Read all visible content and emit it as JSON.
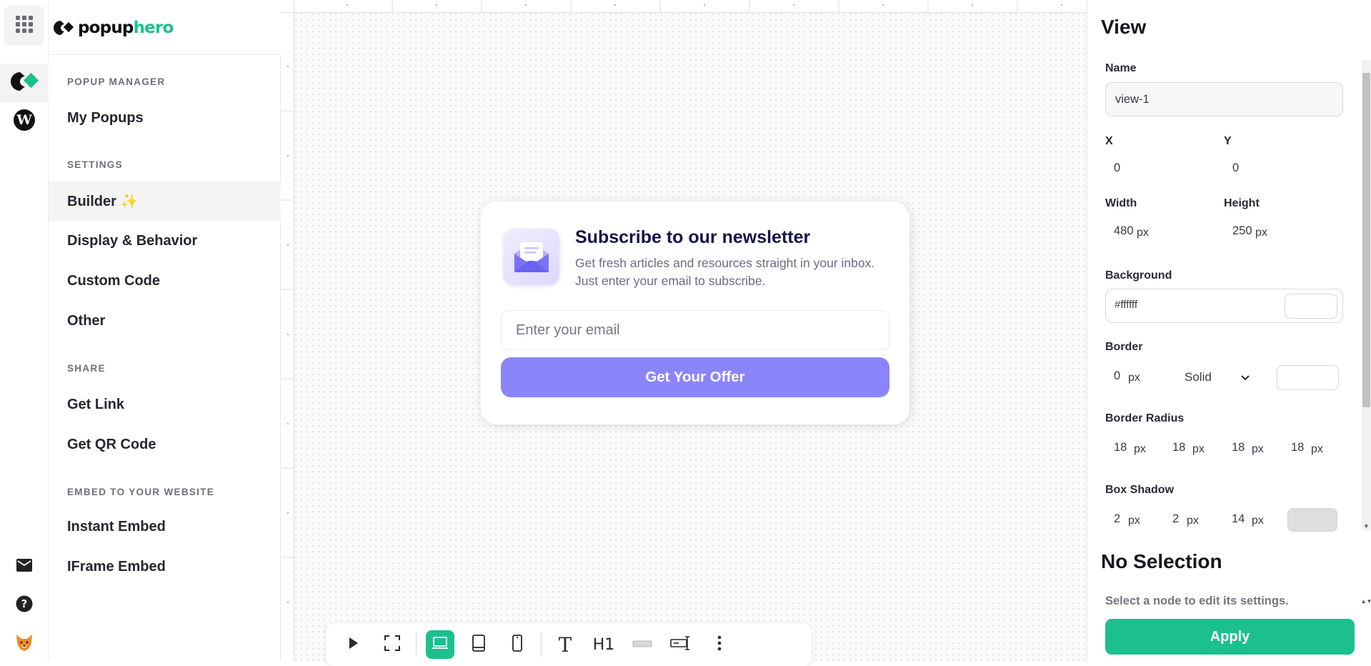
{
  "brand": {
    "part1": "popup",
    "part2": "hero"
  },
  "rail": {
    "apps_icon": "grid-icon",
    "items": [
      {
        "name": "popuphero-logo-icon"
      },
      {
        "name": "wordpress-icon"
      }
    ],
    "bottom": [
      {
        "name": "mail-icon"
      },
      {
        "name": "help-icon"
      },
      {
        "name": "fox-avatar-icon"
      }
    ]
  },
  "nav": {
    "sections": [
      {
        "title": "POPUP MANAGER",
        "items": [
          "My Popups"
        ]
      },
      {
        "title": "SETTINGS",
        "items": [
          "Builder ✨",
          "Display & Behavior",
          "Custom Code",
          "Other"
        ]
      },
      {
        "title": "SHARE",
        "items": [
          "Get Link",
          "Get QR Code"
        ]
      },
      {
        "title": "EMBED TO YOUR WEBSITE",
        "items": [
          "Instant Embed",
          "IFrame Embed"
        ]
      }
    ],
    "active": "Builder ✨"
  },
  "popup": {
    "title": "Subscribe to our newsletter",
    "description": "Get fresh articles and resources straight in your inbox. Just enter your email to subscribe.",
    "email_placeholder": "Enter your email",
    "cta_label": "Get Your Offer",
    "cta_color": "#8b85fb",
    "title_color": "#16124a"
  },
  "toolbar": {
    "items": [
      "play-icon",
      "fullscreen-icon",
      "desktop-icon",
      "tablet-icon",
      "mobile-icon",
      "text-icon",
      "heading-icon",
      "divider-icon",
      "form-input-icon",
      "more-icon"
    ],
    "heading_text": "H1",
    "text_glyph": "T",
    "active": "desktop-icon"
  },
  "panel": {
    "title": "View",
    "name_label": "Name",
    "name_value": "view-1",
    "x_label": "X",
    "x_value": "0",
    "y_label": "Y",
    "y_value": "0",
    "width_label": "Width",
    "width_value": "480",
    "height_label": "Height",
    "height_value": "250",
    "unit": "px",
    "background_label": "Background",
    "background_value": "#ffffff",
    "border_label": "Border",
    "border_width": "0",
    "border_style": "Solid",
    "radius_label": "Border Radius",
    "radius_values": [
      "18",
      "18",
      "18",
      "18"
    ],
    "shadow_label": "Box Shadow",
    "shadow_values": [
      "2",
      "2",
      "14"
    ],
    "no_selection_title": "No Selection",
    "no_selection_hint": "Select a node to edit its settings.",
    "apply_label": "Apply",
    "accent": "#1cc08f"
  }
}
